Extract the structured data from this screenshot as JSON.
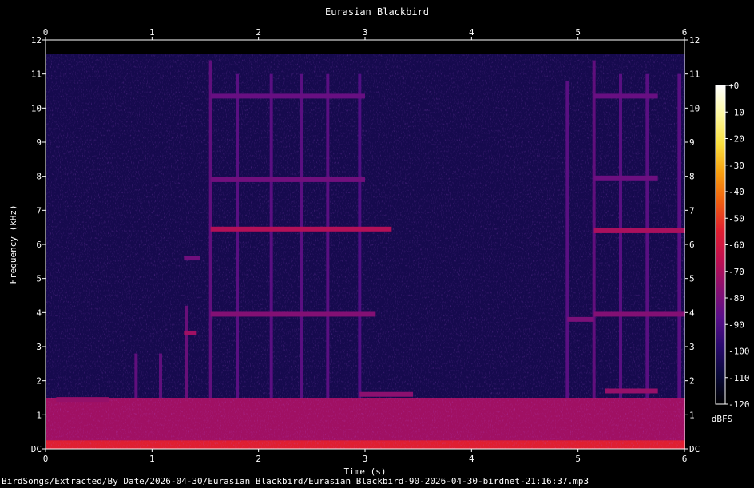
{
  "chart_data": {
    "type": "heatmap",
    "title": "Eurasian Blackbird",
    "xlabel": "Time (s)",
    "ylabel": "Frequency (kHz)",
    "xlim": [
      0,
      6
    ],
    "ylim": [
      0,
      12
    ],
    "x_ticks": [
      {
        "value": 0,
        "label": "0"
      },
      {
        "value": 1,
        "label": "1"
      },
      {
        "value": 2,
        "label": "2"
      },
      {
        "value": 3,
        "label": "3"
      },
      {
        "value": 4,
        "label": "4"
      },
      {
        "value": 5,
        "label": "5"
      },
      {
        "value": 6,
        "label": "6"
      }
    ],
    "y_ticks": [
      {
        "value": 0,
        "label": "DC"
      },
      {
        "value": 1,
        "label": "1"
      },
      {
        "value": 2,
        "label": "2"
      },
      {
        "value": 3,
        "label": "3"
      },
      {
        "value": 4,
        "label": "4"
      },
      {
        "value": 5,
        "label": "5"
      },
      {
        "value": 6,
        "label": "6"
      },
      {
        "value": 7,
        "label": "7"
      },
      {
        "value": 8,
        "label": "8"
      },
      {
        "value": 9,
        "label": "9"
      },
      {
        "value": 10,
        "label": "10"
      },
      {
        "value": 11,
        "label": "11"
      },
      {
        "value": 12,
        "label": "12"
      }
    ],
    "colorbar": {
      "label": "dBFS",
      "range": [
        -120,
        0
      ],
      "ticks": [
        {
          "value": 0,
          "label": "+0"
        },
        {
          "value": -10,
          "label": "-10"
        },
        {
          "value": -20,
          "label": "-20"
        },
        {
          "value": -30,
          "label": "-30"
        },
        {
          "value": -40,
          "label": "-40"
        },
        {
          "value": -50,
          "label": "-50"
        },
        {
          "value": -60,
          "label": "-60"
        },
        {
          "value": -70,
          "label": "-70"
        },
        {
          "value": -80,
          "label": "-80"
        },
        {
          "value": -90,
          "label": "-90"
        },
        {
          "value": -100,
          "label": "-100"
        },
        {
          "value": -110,
          "label": "-110"
        },
        {
          "value": -120,
          "label": "-120"
        }
      ],
      "colors": [
        "#000000",
        "#0a0a3a",
        "#2a0a6e",
        "#5a0f8a",
        "#8a1070",
        "#c01050",
        "#e02030",
        "#f06010",
        "#f8a010",
        "#fae040",
        "#fdf8a0",
        "#ffffff"
      ]
    },
    "background_level_db": -105,
    "noise_floor_band_khz": [
      0,
      1.5
    ],
    "noise_floor_level_db": -72,
    "harmonic_lines": [
      {
        "t0": 1.55,
        "t1": 3.1,
        "freq_khz": 3.95,
        "level_db": -78
      },
      {
        "t0": 1.55,
        "t1": 3.25,
        "freq_khz": 6.45,
        "level_db": -68
      },
      {
        "t0": 1.55,
        "t1": 3.0,
        "freq_khz": 7.9,
        "level_db": -82
      },
      {
        "t0": 1.55,
        "t1": 3.0,
        "freq_khz": 10.35,
        "level_db": -84
      },
      {
        "t0": 5.15,
        "t1": 6.0,
        "freq_khz": 3.95,
        "level_db": -78
      },
      {
        "t0": 5.15,
        "t1": 6.0,
        "freq_khz": 6.4,
        "level_db": -70
      },
      {
        "t0": 5.15,
        "t1": 5.75,
        "freq_khz": 7.95,
        "level_db": -83
      },
      {
        "t0": 5.15,
        "t1": 5.75,
        "freq_khz": 10.35,
        "level_db": -84
      },
      {
        "t0": 4.9,
        "t1": 5.15,
        "freq_khz": 3.8,
        "level_db": -80
      },
      {
        "t0": 1.3,
        "t1": 1.42,
        "freq_khz": 3.4,
        "level_db": -72
      },
      {
        "t0": 1.3,
        "t1": 1.45,
        "freq_khz": 5.6,
        "level_db": -82
      },
      {
        "t0": 2.95,
        "t1": 3.45,
        "freq_khz": 1.6,
        "level_db": -76
      },
      {
        "t0": 5.25,
        "t1": 5.75,
        "freq_khz": 1.7,
        "level_db": -74
      },
      {
        "t0": 0.1,
        "t1": 0.6,
        "freq_khz": 1.45,
        "level_db": -74
      }
    ],
    "vertical_clicks": [
      {
        "t": 0.85,
        "f_top_khz": 2.8,
        "level_db": -84
      },
      {
        "t": 1.08,
        "f_top_khz": 2.8,
        "level_db": -84
      },
      {
        "t": 1.32,
        "f_top_khz": 4.2,
        "level_db": -82
      },
      {
        "t": 1.55,
        "f_top_khz": 11.4,
        "level_db": -84
      },
      {
        "t": 1.8,
        "f_top_khz": 11.0,
        "level_db": -86
      },
      {
        "t": 2.12,
        "f_top_khz": 11.0,
        "level_db": -86
      },
      {
        "t": 2.4,
        "f_top_khz": 11.0,
        "level_db": -86
      },
      {
        "t": 2.65,
        "f_top_khz": 11.0,
        "level_db": -86
      },
      {
        "t": 2.95,
        "f_top_khz": 11.0,
        "level_db": -88
      },
      {
        "t": 4.9,
        "f_top_khz": 10.8,
        "level_db": -86
      },
      {
        "t": 5.15,
        "f_top_khz": 11.4,
        "level_db": -84
      },
      {
        "t": 5.4,
        "f_top_khz": 11.0,
        "level_db": -86
      },
      {
        "t": 5.65,
        "f_top_khz": 11.0,
        "level_db": -86
      },
      {
        "t": 5.95,
        "f_top_khz": 11.0,
        "level_db": -86
      }
    ],
    "grid": false
  },
  "footer": {
    "filename": "BirdSongs/Extracted/By_Date/2026-04-30/Eurasian_Blackbird/Eurasian_Blackbird-90-2026-04-30-birdnet-21:16:37.mp3"
  }
}
